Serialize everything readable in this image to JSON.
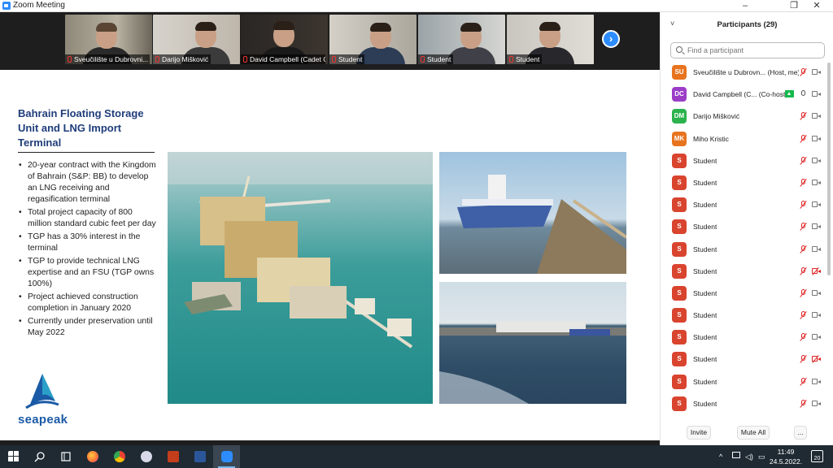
{
  "window": {
    "title": "Zoom Meeting",
    "minimize": "–",
    "maximize": "❐",
    "close": "✕"
  },
  "video_strip": {
    "tiles": [
      {
        "name": "Sveučilište u Dubrovni..."
      },
      {
        "name": "Darijo Mišković"
      },
      {
        "name": "David Campbell (Cadet Co..."
      },
      {
        "name": "Student"
      },
      {
        "name": "Student"
      },
      {
        "name": "Student"
      }
    ],
    "next_icon": "›"
  },
  "slide": {
    "title": "Bahrain Floating Storage Unit and LNG Import Terminal",
    "bullets": [
      "20-year contract with the Kingdom of Bahrain (S&P: BB) to develop an LNG receiving and regasification terminal",
      "Total project capacity of 800 million standard cubic feet per day",
      "TGP has a 30% interest in the terminal",
      "TGP to provide technical LNG expertise and an FSU (TGP owns 100%)",
      "Project achieved construction completion in January 2020",
      "Currently under preservation until May 2022"
    ],
    "logo_text": "seapeak"
  },
  "participants": {
    "title": "Participants (29)",
    "collapse_icon": "˅",
    "search_placeholder": "Find a participant",
    "list": [
      {
        "initials": "SU",
        "color": "#e8731e",
        "name": "Sveučilište u Dubrovn... (Host, me)",
        "mic": "muted",
        "cam": "on",
        "share": false
      },
      {
        "initials": "DC",
        "color": "#9b3cc7",
        "name": "David Campbell (C... (Co-host)",
        "mic": "on",
        "cam": "on",
        "share": true
      },
      {
        "initials": "DM",
        "color": "#2bb24c",
        "name": "Darijo Mišković",
        "mic": "muted",
        "cam": "on",
        "share": false
      },
      {
        "initials": "MK",
        "color": "#e8731e",
        "name": "Miho Kristic",
        "mic": "muted",
        "cam": "on",
        "share": false
      },
      {
        "initials": "S",
        "color": "#d9442e",
        "name": "Student",
        "mic": "muted",
        "cam": "on",
        "share": false
      },
      {
        "initials": "S",
        "color": "#d9442e",
        "name": "Student",
        "mic": "muted",
        "cam": "on",
        "share": false
      },
      {
        "initials": "S",
        "color": "#d9442e",
        "name": "Student",
        "mic": "muted",
        "cam": "on",
        "share": false
      },
      {
        "initials": "S",
        "color": "#d9442e",
        "name": "Student",
        "mic": "muted",
        "cam": "on",
        "share": false
      },
      {
        "initials": "S",
        "color": "#d9442e",
        "name": "Student",
        "mic": "muted",
        "cam": "on",
        "share": false
      },
      {
        "initials": "S",
        "color": "#d9442e",
        "name": "Student",
        "mic": "muted",
        "cam": "off",
        "share": false
      },
      {
        "initials": "S",
        "color": "#d9442e",
        "name": "Student",
        "mic": "muted",
        "cam": "on",
        "share": false
      },
      {
        "initials": "S",
        "color": "#d9442e",
        "name": "Student",
        "mic": "muted",
        "cam": "on",
        "share": false
      },
      {
        "initials": "S",
        "color": "#d9442e",
        "name": "Student",
        "mic": "muted",
        "cam": "on",
        "share": false
      },
      {
        "initials": "S",
        "color": "#d9442e",
        "name": "Student",
        "mic": "muted",
        "cam": "off",
        "share": false
      },
      {
        "initials": "S",
        "color": "#d9442e",
        "name": "Student",
        "mic": "muted",
        "cam": "on",
        "share": false
      },
      {
        "initials": "S",
        "color": "#d9442e",
        "name": "Student",
        "mic": "muted",
        "cam": "on",
        "share": false
      }
    ],
    "invite_label": "Invite",
    "mute_all_label": "Mute All",
    "more_label": "..."
  },
  "taskbar": {
    "icons": [
      "windows-start-icon",
      "search-icon",
      "task-view-icon",
      "firefox-icon",
      "chrome-icon",
      "app-icon",
      "powerpoint-icon",
      "word-icon",
      "zoom-icon"
    ],
    "overflow_icon": "^",
    "time": "11:49",
    "date": "24.5.2022.",
    "notifications": "20"
  }
}
